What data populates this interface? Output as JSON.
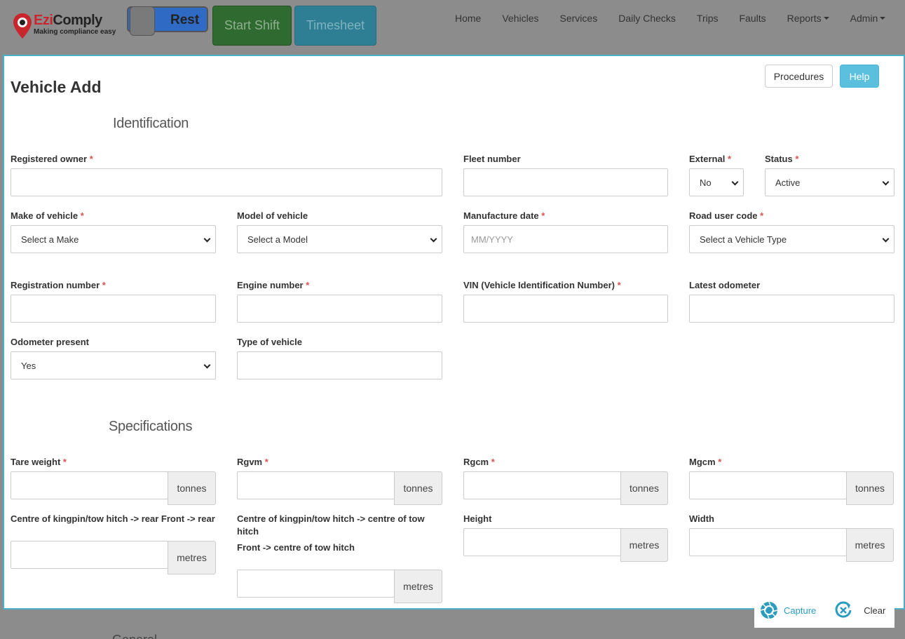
{
  "header": {
    "logo": {
      "name_prefix": "Ezi",
      "name_suffix": "Comply",
      "tagline": "Making compliance easy"
    },
    "toggle_label": "Rest",
    "start_shift": "Start Shift",
    "timesheet": "Timesheet",
    "nav": [
      "Home",
      "Vehicles",
      "Services",
      "Daily Checks",
      "Trips",
      "Faults",
      "Reports",
      "Admin"
    ]
  },
  "page": {
    "title": "Vehicle Add",
    "procedures": "Procedures",
    "help": "Help"
  },
  "identification": {
    "title": "Identification",
    "registered_owner": {
      "label": "Registered owner",
      "value": ""
    },
    "fleet_number": {
      "label": "Fleet number",
      "value": ""
    },
    "external": {
      "label": "External",
      "value": "No"
    },
    "status": {
      "label": "Status",
      "value": "Active"
    },
    "make": {
      "label": "Make of vehicle",
      "value": "Select a Make"
    },
    "model": {
      "label": "Model of vehicle",
      "value": "Select a Model"
    },
    "manufacture_date": {
      "label": "Manufacture date",
      "placeholder": "MM/YYYY"
    },
    "road_user_code": {
      "label": "Road user code",
      "value": "Select a Vehicle Type"
    },
    "registration_number": {
      "label": "Registration number",
      "value": ""
    },
    "engine_number": {
      "label": "Engine number",
      "value": ""
    },
    "vin": {
      "label": "VIN (Vehicle Identification Number)",
      "value": ""
    },
    "latest_odometer": {
      "label": "Latest odometer",
      "value": ""
    },
    "odometer_present": {
      "label": "Odometer present",
      "value": "Yes"
    },
    "type_of_vehicle": {
      "label": "Type of vehicle",
      "value": ""
    }
  },
  "specifications": {
    "title": "Specifications",
    "tare_weight": {
      "label": "Tare weight",
      "unit": "tonnes"
    },
    "rgvm": {
      "label": "Rgvm",
      "unit": "tonnes"
    },
    "rgcm": {
      "label": "Rgcm",
      "unit": "tonnes"
    },
    "mgcm": {
      "label": "Mgcm",
      "unit": "tonnes"
    },
    "kingpin_rear": {
      "label": "Centre of kingpin/tow hitch -> rear Front -> rear",
      "unit": "metres"
    },
    "kingpin_centre": {
      "label_line1": "Centre of kingpin/tow hitch -> centre of tow",
      "label_line2": "hitch",
      "label_line3": "Front -> centre of tow hitch",
      "unit": "metres"
    },
    "height": {
      "label": "Height",
      "unit": "metres"
    },
    "width": {
      "label": "Width",
      "unit": "metres"
    }
  },
  "capture_bar": {
    "capture": "Capture",
    "clear": "Clear"
  },
  "below_panel": "General"
}
